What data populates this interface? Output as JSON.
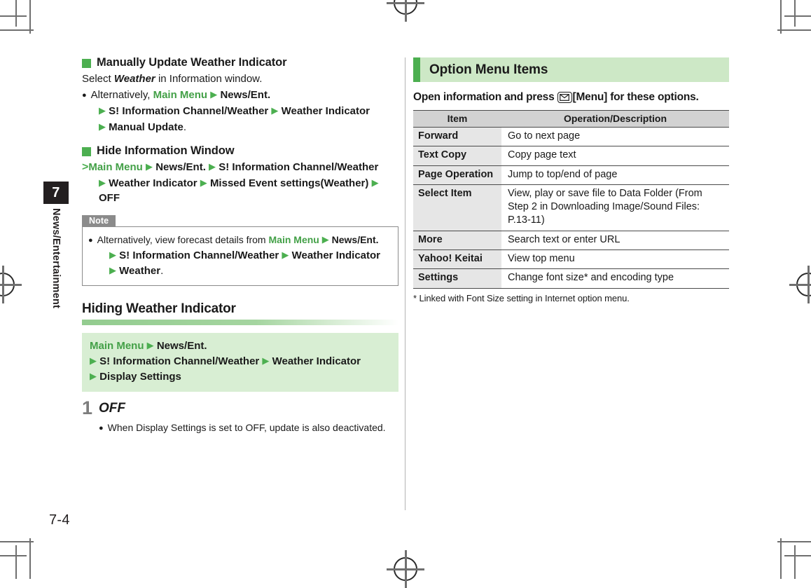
{
  "page": {
    "number": "7-4",
    "chapter_number": "7",
    "chapter_name": "News/Entertainment"
  },
  "left_column": {
    "block1": {
      "heading": "Manually Update Weather Indicator",
      "intro_pre": "Select ",
      "intro_italic": "Weather",
      "intro_post": " in Information window.",
      "bullet_pre": "Alternatively, ",
      "path_main_menu": "Main Menu",
      "path_step2": "News/Ent.",
      "path_step3": "S! Information Channel/Weather",
      "path_step4": "Weather Indicator",
      "path_step5": "Manual Update",
      "path_end_period": "."
    },
    "block2": {
      "heading": "Hide Information Window",
      "path_main_menu": "Main Menu",
      "path_step2": "News/Ent.",
      "path_step3": "S! Information Channel/Weather",
      "path_step4": "Weather Indicator",
      "path_step5": "Missed Event settings(Weather)",
      "path_step6": "OFF"
    },
    "note": {
      "tab_label": "Note",
      "text_pre": "Alternatively, view forecast details from ",
      "path_main_menu": "Main Menu",
      "path_step2": "News/Ent.",
      "path_step3": "S! Information Channel/Weather",
      "path_step4": "Weather Indicator",
      "path_step5": "Weather",
      "path_end_period": "."
    },
    "section": {
      "title": "Hiding Weather Indicator",
      "path_main_menu": "Main Menu",
      "path_step2": "News/Ent.",
      "path_step3": "S! Information Channel/Weather",
      "path_step4": "Weather Indicator",
      "path_step5": "Display Settings",
      "step_number": "1",
      "step_title": "OFF",
      "step_note_pre": "When Display Settings is set to ",
      "step_note_italic": "OFF",
      "step_note_post": ", update is also deactivated."
    }
  },
  "right_column": {
    "panel_title": "Option Menu Items",
    "intro_pre": "Open information and press ",
    "intro_key_icon": "envelope-key-icon",
    "intro_post": "[Menu] for these options.",
    "table": {
      "headers": [
        "Item",
        "Operation/Description"
      ],
      "rows": [
        {
          "item": "Forward",
          "description": "Go to next page"
        },
        {
          "item": "Text Copy",
          "description": "Copy page text"
        },
        {
          "item": "Page Operation",
          "description": "Jump to top/end of page"
        },
        {
          "item": "Select Item",
          "description": "View, play or save file to Data Folder (From Step 2 in Downloading Image/Sound Files: P.13-11)"
        },
        {
          "item": "More",
          "description": "Search text or enter URL"
        },
        {
          "item": "Yahoo! Keitai",
          "description": "View top menu"
        },
        {
          "item": "Settings",
          "description": "Change font size* and encoding type"
        }
      ]
    },
    "footnote": "* Linked with Font Size setting in Internet option menu."
  },
  "icons": {
    "triangle": "▶",
    "bullet_dot": "●",
    "gt_marker": "＞",
    "green_square": "■"
  },
  "colors": {
    "accent_green": "#4caf50",
    "panel_green": "#cde8c6",
    "path_box_green": "#d8eed3",
    "table_header_gray": "#d2d2d2",
    "table_item_gray": "#e6e6e6",
    "chapter_tab_black": "#231f20"
  }
}
